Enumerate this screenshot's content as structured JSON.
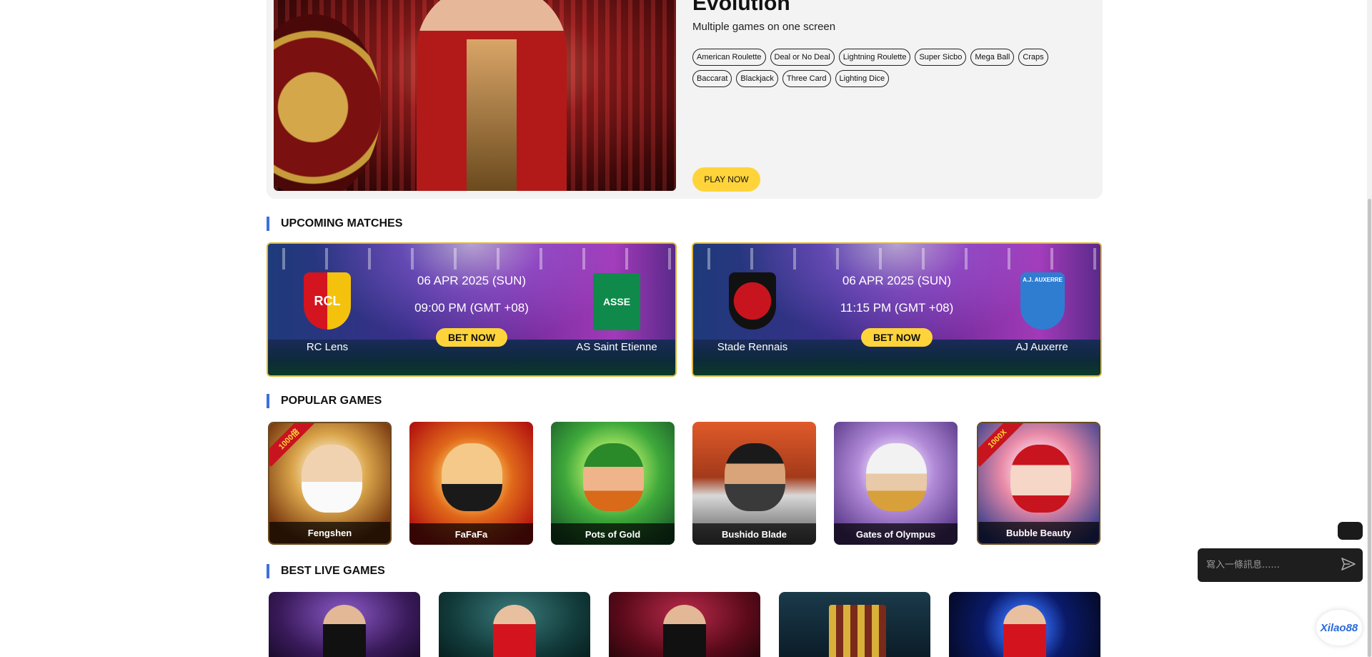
{
  "feature": {
    "title": "Evolution",
    "subtitle": "Multiple games on one screen",
    "tags": [
      "American Roulette",
      "Deal or No Deal",
      "Lightning Roulette",
      "Super Sicbo",
      "Mega Ball",
      "Craps",
      "Baccarat",
      "Blackjack",
      "Three Card",
      "Lighting Dice"
    ],
    "play_label": "PLAY NOW"
  },
  "sections": {
    "upcoming": "UPCOMING MATCHES",
    "popular": "POPULAR GAMES",
    "live": "BEST LIVE GAMES"
  },
  "matches": [
    {
      "date": "06 APR 2025 (SUN)",
      "time": "09:00 PM (GMT +08)",
      "home": "RC Lens",
      "away": "AS Saint Etienne",
      "home_crest_text": "RCL",
      "away_crest_text": "ASSE",
      "bet_label": "BET NOW"
    },
    {
      "date": "06 APR 2025 (SUN)",
      "time": "11:15 PM (GMT +08)",
      "home": "Stade Rennais",
      "away": "AJ Auxerre",
      "home_crest_text": "",
      "away_crest_text": "A.J. AUXERRE",
      "bet_label": "BET NOW"
    }
  ],
  "popular_games": [
    {
      "name": "Fengshen",
      "badge": "1000倍"
    },
    {
      "name": "FaFaFa",
      "badge": ""
    },
    {
      "name": "Pots of Gold",
      "badge": ""
    },
    {
      "name": "Bushido Blade",
      "badge": ""
    },
    {
      "name": "Gates of Olympus",
      "badge": ""
    },
    {
      "name": "Bubble Beauty",
      "badge": "1000X"
    }
  ],
  "chat": {
    "placeholder": "寫入一條訊息......"
  },
  "brand": "Xilao88"
}
